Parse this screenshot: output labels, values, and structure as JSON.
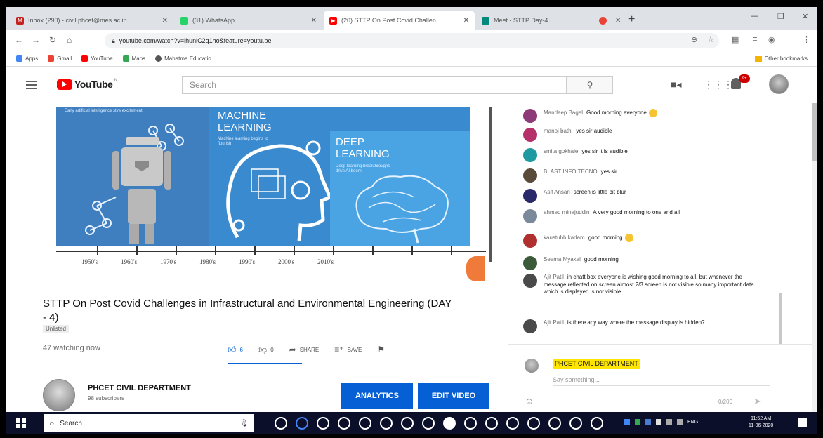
{
  "browser": {
    "tabs": [
      {
        "title": "Inbox (290) - civil.phcet@mes.ac.in",
        "color": "#c5221f",
        "active": false
      },
      {
        "title": "(31) WhatsApp",
        "color": "#25d366",
        "active": false
      },
      {
        "title": "(20) STTP On Post Covid Challen…",
        "color": "#ff0000",
        "active": true
      },
      {
        "title": "Meet - STTP Day-4",
        "color": "#00897b",
        "active": false
      },
      {
        "title": "",
        "color": "#ea4335",
        "active": false
      }
    ],
    "new_tab": "+",
    "window": {
      "minimize": "—",
      "restore": "❐",
      "close": "✕"
    },
    "url": "youtube.com/watch?v=ihuniC2q1ho&feature=youtu.be",
    "bookmarks": [
      {
        "label": "Apps",
        "color": "#4285f4"
      },
      {
        "label": "Gmail",
        "color": "#ea4335"
      },
      {
        "label": "YouTube",
        "color": "#ff0000"
      },
      {
        "label": "Maps",
        "color": "#34a853"
      },
      {
        "label": "Mahatma Educatio…",
        "color": "#555555"
      }
    ],
    "other_bookmarks": "Other bookmarks"
  },
  "youtube": {
    "logo": "YouTube",
    "logo_suffix": "IN",
    "search_placeholder": "Search",
    "notification_count": "9+"
  },
  "video": {
    "ai_caption": "Early artificial intelligence stirs excitement.",
    "ml_title": "MACHINE LEARNING",
    "ml_caption": "Machine learning begins to flourish.",
    "dl_title": "DEEP LEARNING",
    "dl_caption": "Deep learning breakthroughs drive AI boom.",
    "timeline": [
      "1950's",
      "1960's",
      "1970's",
      "1980's",
      "1990's",
      "2000's",
      "2010's"
    ],
    "title": "STTP On Post Covid Challenges in Infrastructural and Environmental Engineering (DAY - 4)",
    "privacy": "Unlisted",
    "watching": "47 watching now",
    "likes": "6",
    "dislikes": "0",
    "share_label": "SHARE",
    "save_label": "SAVE",
    "more_label": "···",
    "channel_name": "PHCET CIVIL DEPARTMENT",
    "subscribers": "98 subscribers",
    "analytics_label": "ANALYTICS",
    "edit_label": "EDIT VIDEO"
  },
  "chat": {
    "messages": [
      {
        "author": "Mandeep Bagal",
        "text": "Good morning everyone",
        "avatar": "#8e3a78",
        "emoji": true
      },
      {
        "author": "manoj bathi",
        "text": "yes sir audible",
        "avatar": "#b5306b",
        "emoji": false
      },
      {
        "author": "smita gokhale",
        "text": "yes sir it is audible",
        "avatar": "#1e9aa0",
        "emoji": false
      },
      {
        "author": "BLAST INFO TECNO",
        "text": "yes sir",
        "avatar": "#5a4a3a",
        "emoji": false
      },
      {
        "author": "Asif Ansari",
        "text": "screen is little bit blur",
        "avatar": "#2a2a6a",
        "emoji": false
      },
      {
        "author": "ahmed minajuddin",
        "text": "A very good morning to one and all",
        "avatar": "#7a8a9a",
        "emoji": false
      },
      {
        "author": "kaustubh kadam",
        "text": "good morning",
        "avatar": "#b03030",
        "emoji": true
      },
      {
        "author": "Seema Myakal",
        "text": "good morning",
        "avatar": "#3a5a3a",
        "emoji": false
      },
      {
        "author": "Ajit Patil",
        "text": "in chatt box everyone is wishing good morning to all, but whenever the message reflected on screen almost 2/3 screen is not visible so many important data which is displayed is not visible",
        "avatar": "#4a4a4a",
        "emoji": false
      },
      {
        "author": "Ajit Patil",
        "text": "is there any way where the message display is hidden?",
        "avatar": "#4a4a4a",
        "emoji": false
      }
    ],
    "input_name": "PHCET CIVIL DEPARTMENT",
    "input_placeholder": "Say something...",
    "char_count": "0/200"
  },
  "taskbar": {
    "search_label": "Search",
    "time": "11:52 AM",
    "date": "11-06-2020",
    "lang": "ENG"
  }
}
